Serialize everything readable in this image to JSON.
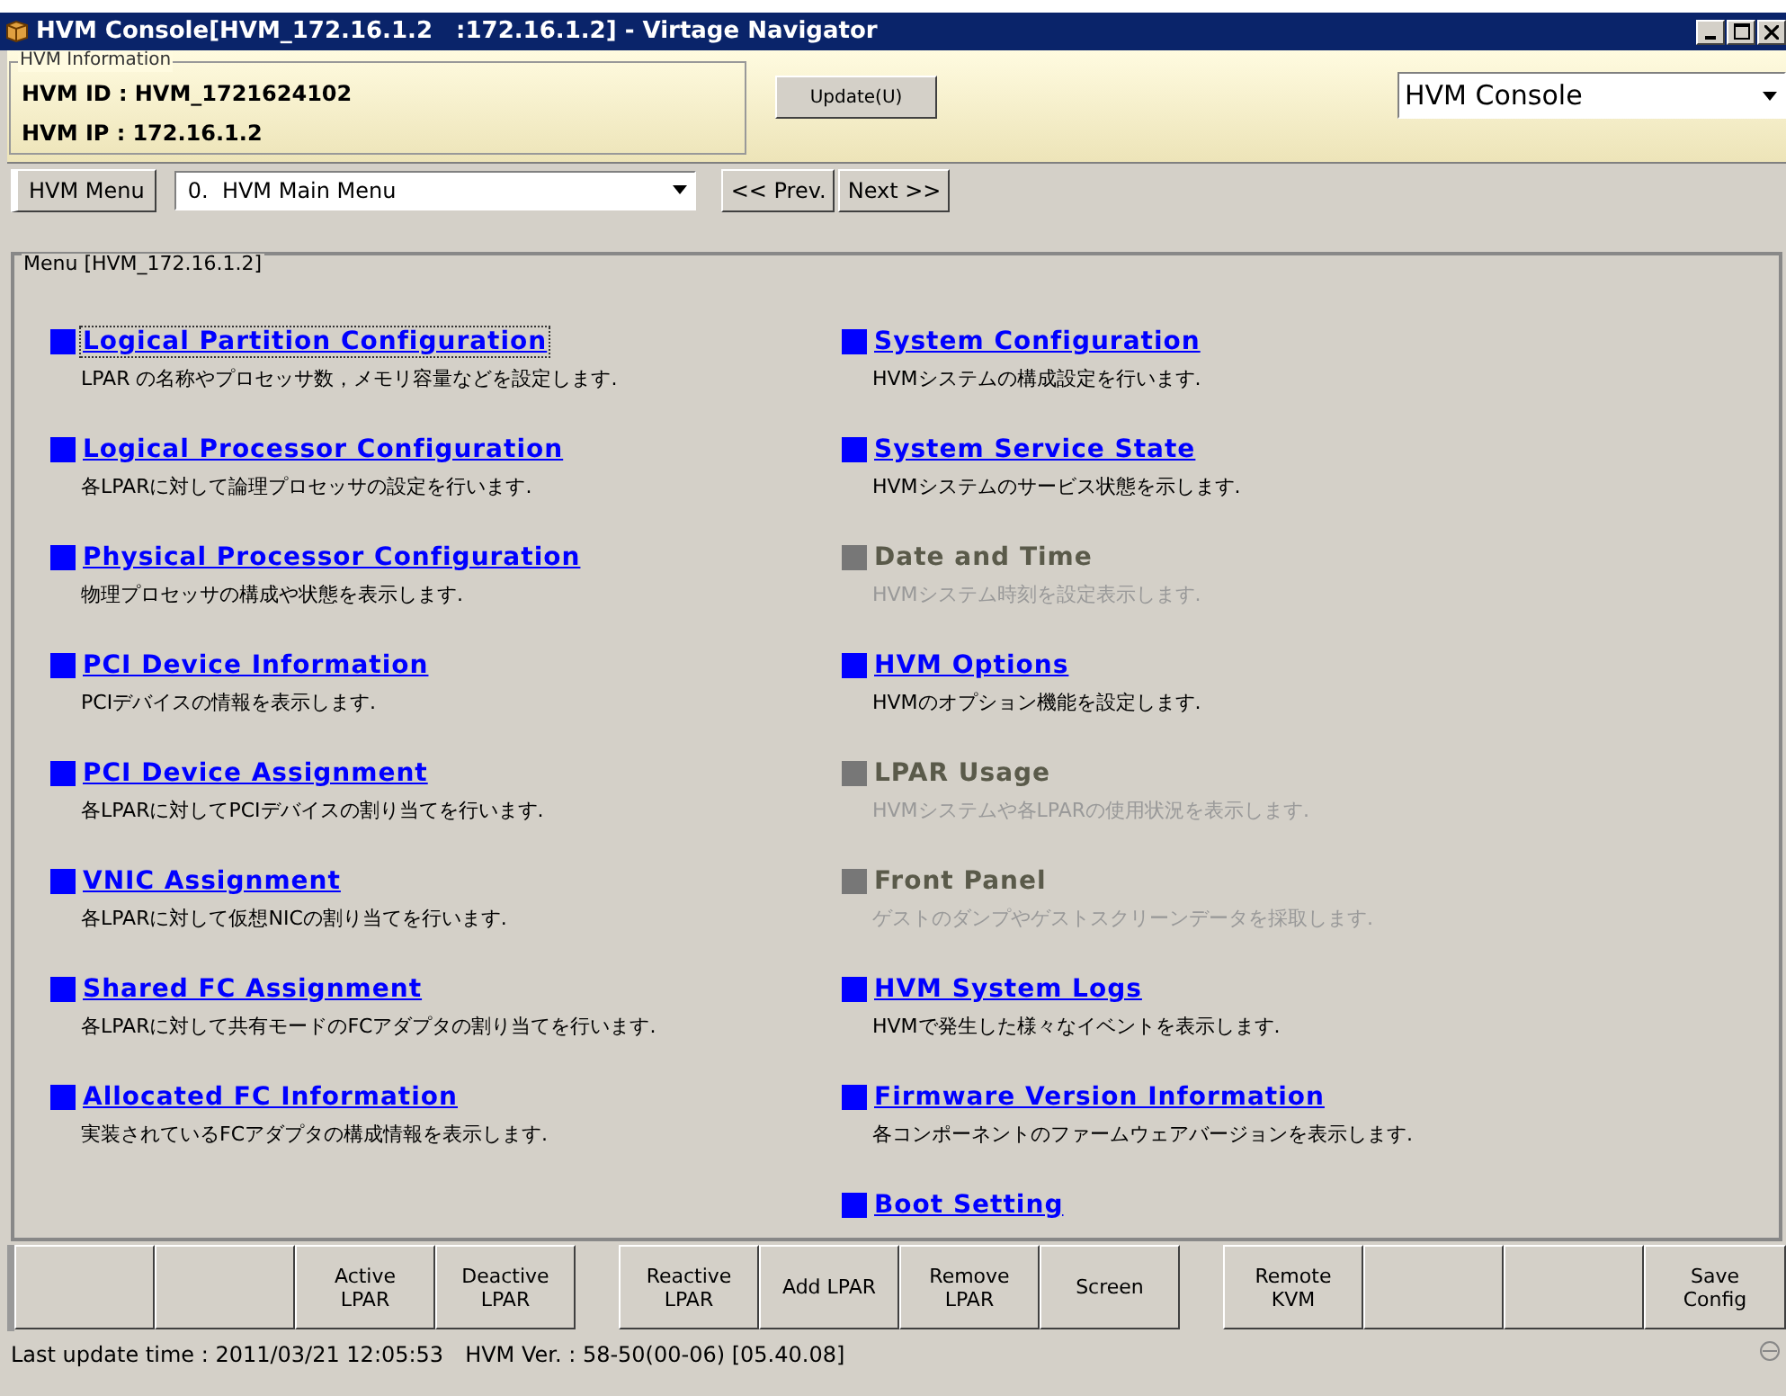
{
  "window": {
    "title": "HVM Console[HVM_172.16.1.2　:172.16.1.2] - Virtage Navigator"
  },
  "hvm_information": {
    "legend": "HVM Information",
    "id_label": "HVM ID :",
    "id_value": "HVM_1721624102",
    "ip_label": "HVM IP :",
    "ip_value": "172.16.1.2"
  },
  "update_button": "Update(U)",
  "view_select": {
    "value": "HVM Console"
  },
  "toolbar": {
    "menu_label": "HVM Menu",
    "menu_select": "0.  HVM Main Menu",
    "prev": "<< Prev.",
    "next": "Next >>"
  },
  "menu": {
    "legend": "Menu [HVM_172.16.1.2]",
    "columns": [
      [
        {
          "title": "Logical Partition Configuration",
          "description": "LPAR の名称やプロセッサ数，メモリ容量などを設定します.",
          "enabled": true,
          "focused": true
        },
        {
          "title": "Logical Processor Configuration",
          "description": "各LPARに対して論理プロセッサの設定を行います.",
          "enabled": true,
          "focused": false
        },
        {
          "title": "Physical Processor Configuration",
          "description": "物理プロセッサの構成や状態を表示します.",
          "enabled": true,
          "focused": false
        },
        {
          "title": "PCI Device Information",
          "description": "PCIデバイスの情報を表示します.",
          "enabled": true,
          "focused": false
        },
        {
          "title": "PCI Device Assignment",
          "description": "各LPARに対してPCIデバイスの割り当てを行います.",
          "enabled": true,
          "focused": false
        },
        {
          "title": "VNIC Assignment",
          "description": "各LPARに対して仮想NICの割り当てを行います.",
          "enabled": true,
          "focused": false
        },
        {
          "title": "Shared FC Assignment",
          "description": "各LPARに対して共有モードのFCアダプタの割り当てを行います.",
          "enabled": true,
          "focused": false
        },
        {
          "title": "Allocated FC Information",
          "description": "実装されているFCアダプタの構成情報を表示します.",
          "enabled": true,
          "focused": false
        }
      ],
      [
        {
          "title": "System Configuration",
          "description": "HVMシステムの構成設定を行います.",
          "enabled": true,
          "focused": false
        },
        {
          "title": "System Service State",
          "description": "HVMシステムのサービス状態を示します.",
          "enabled": true,
          "focused": false
        },
        {
          "title": "Date and Time",
          "description": "HVMシステム時刻を設定表示します.",
          "enabled": false,
          "focused": false
        },
        {
          "title": "HVM Options",
          "description": "HVMのオプション機能を設定します.",
          "enabled": true,
          "focused": false
        },
        {
          "title": "LPAR Usage",
          "description": "HVMシステムや各LPARの使用状況を表示します.",
          "enabled": false,
          "focused": false
        },
        {
          "title": "Front Panel",
          "description": "ゲストのダンプやゲストスクリーンデータを採取します.",
          "enabled": false,
          "focused": false
        },
        {
          "title": "HVM System Logs",
          "description": "HVMで発生した様々なイベントを表示します.",
          "enabled": true,
          "focused": false
        },
        {
          "title": "Firmware Version Information",
          "description": "各コンポーネントのファームウェアバージョンを表示します.",
          "enabled": true,
          "focused": false
        },
        {
          "title": "Boot Setting",
          "enabled": true,
          "focused": false
        }
      ]
    ]
  },
  "function_keys": [
    [
      {
        "kind": "blank"
      },
      {
        "kind": "blank"
      },
      {
        "kind": "key",
        "label": "Active\nLPAR"
      },
      {
        "kind": "key",
        "label": "Deactive\nLPAR"
      }
    ],
    [
      {
        "kind": "key",
        "label": "Reactive\nLPAR"
      },
      {
        "kind": "key",
        "label": "Add LPAR"
      },
      {
        "kind": "key",
        "label": "Remove\nLPAR"
      },
      {
        "kind": "key",
        "label": "Screen"
      }
    ],
    [
      {
        "kind": "key",
        "label": "Remote\nKVM"
      },
      {
        "kind": "blank"
      },
      {
        "kind": "blank"
      },
      {
        "kind": "key",
        "label": "Save\nConfig"
      }
    ]
  ],
  "status_bar": {
    "text": "Last update time : 2011/03/21 12:05:53　HVM Ver. : 58-50(00-06) [05.40.08]"
  }
}
